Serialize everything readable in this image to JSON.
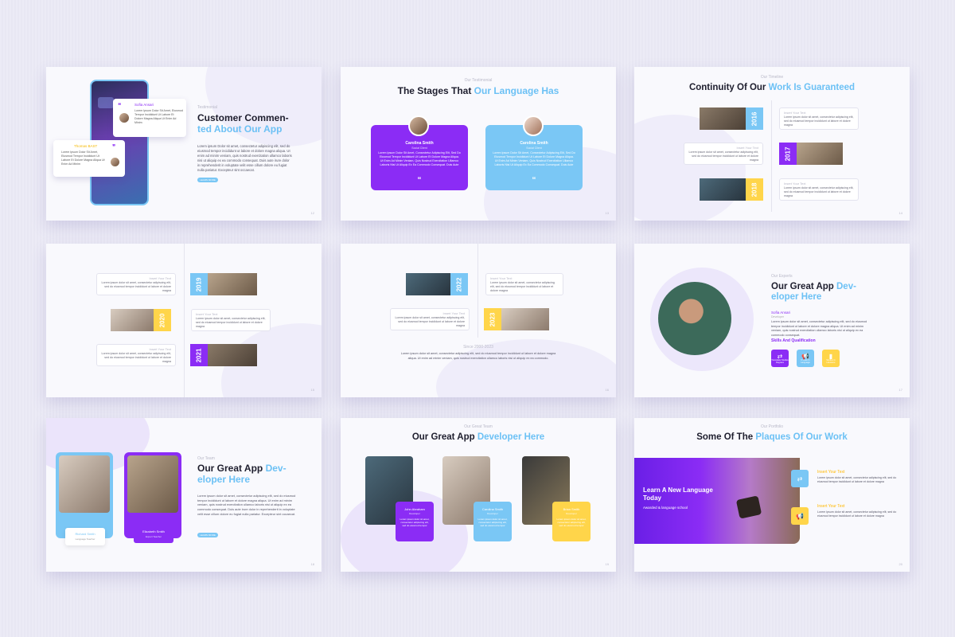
{
  "slides": {
    "testimonial": {
      "label": "Testimonial",
      "title_line1": "Customer Commen-",
      "title_hl": "ted About Our App",
      "body": "Lorem ipsum Dolor sit amet, consectetur adipiscing elit, sed do eiusmod tempor incididunt ut labore et dolore magna aliqua. Ut enim ad minim veniam, quis nostrud exercitation ullamco laboris nisi ut aliquip ex ea commodo consequat. Duis aute irure dolor in reprehenderit in voluptate velit esse cillum dolore eu fugiat nulla pariatur. Excepteur sint occaecat.",
      "button": "LEARN MORE",
      "bubble1_name": "Sofia Ansari",
      "bubble1_text": "Lorem Ipsum Dolor Sit Amet, Eiusmod Tempor Incididunt Ut Labore Et Dolore Magna Aliqua Ut Enim Ad Minim",
      "bubble2_name": "Thomas BAST",
      "bubble2_text": "Lorem Ipsum Dolor Sit Amet, Eiusmod Tempor Incididunt Ut Labore Et Dolore Magna Aliqua Ut Enim Ad Minim",
      "page": "12"
    },
    "stages": {
      "label": "Our Testimonial",
      "title": "The Stages That ",
      "title_hl": "Our Language Has",
      "card1_name": "Carolina Smith",
      "card1_role": "Social Client",
      "card2_name": "Carolina Smith",
      "card2_role": "Social Client",
      "card_text": "Lorem Ipsum Dolor Sit Amet, Consectetur Adipiscing Elit, Sed Do Eiusmod Tempor Incididunt Ut Labore Et Dolore Magna Aliqua. Ut Enim Ad Minim Veniam, Quis Nostrud Exercitation Ullamco Laboris Nisi Ut Aliquip Ex Ea Commodo Consequat. Duis Aute",
      "quote": "“",
      "page": "13"
    },
    "continuity": {
      "label": "Our Timeline",
      "title": "Continuity Of Our ",
      "title_hl": "Work Is Guaranteed",
      "entries": [
        {
          "year": "2016",
          "heading": "Insert Your Text",
          "text": "Lorem ipsum dolor sit amet, consectetur adipiscing elit, sed do eiusmod tempor incididunt ut labore et dolore magna"
        },
        {
          "year": "2017",
          "heading": "Insert Your Text",
          "text": "Lorem ipsum dolor sit amet, consectetur adipiscing elit, sed do eiusmod tempor incididunt ut labore et dolore magna"
        },
        {
          "year": "2018",
          "heading": "Insert Your Text",
          "text": "Lorem ipsum dolor sit amet, consectetur adipiscing elit, sed do eiusmod tempor incididunt ut labore et dolore magna"
        }
      ],
      "page": "14"
    },
    "timeline2": {
      "entries": [
        {
          "year": "2019",
          "heading": "Insert Your Text",
          "text": "Lorem ipsum dolor sit amet, consectetur adipiscing elit, sed do eiusmod tempor incididunt ut labore et dolore magna"
        },
        {
          "year": "2020",
          "heading": "Insert Your Text",
          "text": "Lorem ipsum dolor sit amet, consectetur adipiscing elit, sed do eiusmod tempor incididunt ut labore et dolore magna"
        },
        {
          "year": "2021",
          "heading": "Insert Your Text",
          "text": "Lorem ipsum dolor sit amet, consectetur adipiscing elit, sed do eiusmod tempor incididunt ut labore et dolore magna"
        }
      ],
      "page": "15"
    },
    "timeline3": {
      "entries": [
        {
          "year": "2022",
          "heading": "Insert Your Text",
          "text": "Lorem ipsum dolor sit amet, consectetur adipiscing elit, sed do eiusmod tempor incididunt ut labore et dolore magna"
        },
        {
          "year": "2023",
          "heading": "Insert Your Text",
          "text": "Lorem ipsum dolor sit amet, consectetur adipiscing elit, sed do eiusmod tempor incididunt ut labore et dolore magna"
        }
      ],
      "since": "Since 2000-2023",
      "since_text": "Lorem ipsum dolor sit amet, consectetur adipiscing elit, sed do eiusmod tempor incididunt ut labore et dolore magna aliqua. Ut enim ad minim veniam, quis nostrud exercitation ullamco laboris nisi ut aliquip ex ea commodo.",
      "page": "16"
    },
    "expert": {
      "label": "Our Experts",
      "title_line1": "Our Great App ",
      "title_hl1": "Dev-",
      "title_hl2": "eloper Here",
      "name": "Sofia Ansari",
      "role": "Developer",
      "body": "Lorem ipsum dolor sit amet, consectetur adipiscing elit, sed do eiusmod tempor incididunt ut labore et dolore magna aliqua. Ut enim ad minim veniam, quis nostrud exercitation ullamco laboris nisi ut aliquip ex ea commodo consequat.",
      "skills": "Skills And Qualification",
      "skill_items": [
        "Translates Studies Degrees",
        "It Uses In Language",
        "Studies In Literature"
      ],
      "page": "17"
    },
    "team_duo": {
      "label": "Our Team",
      "title_line1": "Our Great App ",
      "title_hl1": "Dev-",
      "title_hl2": "eloper Here",
      "body": "Lorem ipsum dolor sit amet, consectetur adipiscing elit, sed do eiusmod tempor incididunt ut labore et dolore magna aliqua. Ut enim ad minim veniam, quis nostrud exercitation ullamco laboris nisi ut aliquip ex ea commodo consequat. Duis aute irure dolor in reprehenderit in voluptate velit esse cillum dolore eu fugiat nulla pariatur. Excepteur sint occaecat.",
      "button": "LEARN MORE",
      "member1_name": "Richard Smith",
      "member1_role": "Language Teacher",
      "member2_name": "Elizabeth Smith",
      "member2_role": "Expert Teacher",
      "page": "18"
    },
    "team_trio": {
      "label": "Our Great Team",
      "title": "Our Great App ",
      "title_hl": "Developer Here",
      "members": [
        {
          "name": "John Abraham",
          "role": "Developer",
          "text": "Lorem ipsum dolor sit amet, consectetur adipiscing elit, sed do eiusmod tempor"
        },
        {
          "name": "Carolina Smith",
          "role": "Developer",
          "text": "Lorem ipsum dolor sit amet, consectetur adipiscing elit, sed do eiusmod tempor"
        },
        {
          "name": "Brian Smith",
          "role": "Developer",
          "text": "Lorem ipsum dolor sit amet, consectetur adipiscing elit, sed do eiusmod tempor"
        }
      ],
      "page": "19"
    },
    "plaques": {
      "label": "Our Portfolio",
      "title": "Some Of The ",
      "title_hl": "Plaques Of Our Work",
      "banner_title": "Learn A New Language Today",
      "banner_sub": "Awarded & language school",
      "items": [
        {
          "heading": "Insert Your Text",
          "text": "Lorem ipsum dolor sit amet, consectetur adipiscing elit, sed do eiusmod tempor incididunt ut labore et dolore magna"
        },
        {
          "heading": "Insert Your Text",
          "text": "Lorem ipsum dolor sit amet, consectetur adipiscing elit, sed do eiusmod tempor incididunt ut labore et dolore magna"
        }
      ],
      "page": "20"
    }
  },
  "colors": {
    "purple": "#8b2cf5",
    "blue": "#7ac7f5",
    "yellow": "#ffd54a",
    "background": "#eae9f5"
  },
  "icons": [
    "quote-icon",
    "shuffle-icon",
    "megaphone-icon",
    "book-icon"
  ]
}
